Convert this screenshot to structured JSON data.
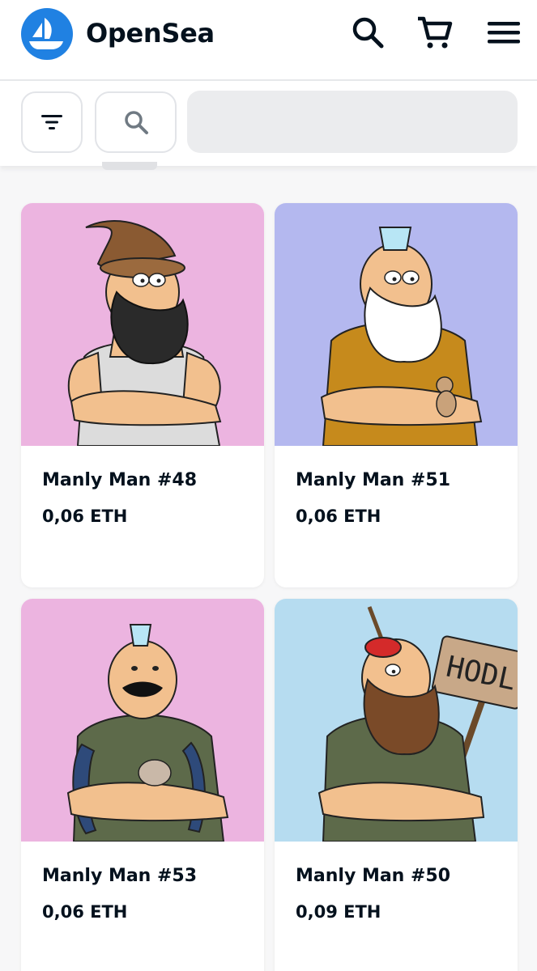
{
  "header": {
    "brand": "OpenSea",
    "icons": [
      "opensea-logo-icon",
      "search-icon",
      "cart-icon",
      "menu-icon"
    ]
  },
  "filters": {
    "icons": [
      "filter-icon",
      "search-icon"
    ],
    "search_value": ""
  },
  "colors": {
    "accent": "#2081e2",
    "pink_bg": "#ecb4e0",
    "lavender_bg": "#b4b8ef",
    "sky_bg": "#b6dcf0"
  },
  "items": [
    {
      "name": "Manly Man #48",
      "price": "0,06 ETH"
    },
    {
      "name": "Manly Man #51",
      "price": "0,06 ETH"
    },
    {
      "name": "Manly Man #53",
      "price": "0,06 ETH"
    },
    {
      "name": "Manly Man #50",
      "price": "0,09 ETH"
    }
  ],
  "sign_text": "HODL"
}
